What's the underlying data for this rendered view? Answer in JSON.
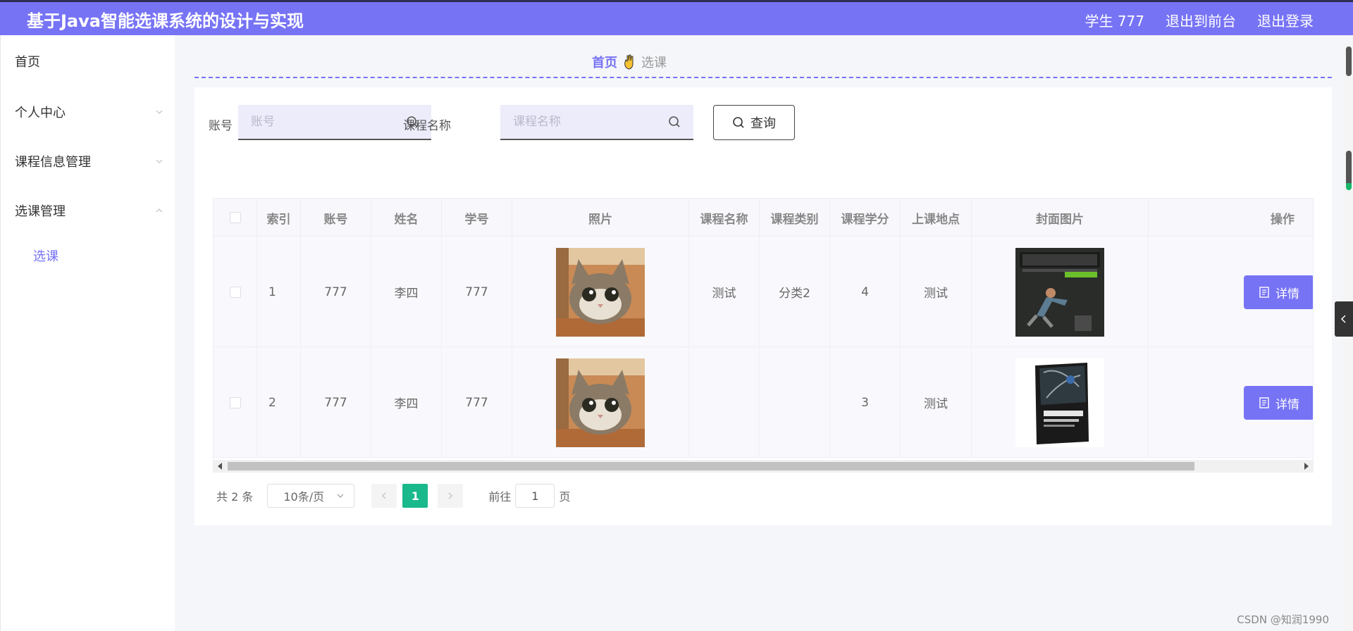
{
  "header": {
    "title": "基于Java智能选课系统的设计与实现",
    "user_label": "学生 777",
    "front_link": "退出到前台",
    "logout_link": "退出登录"
  },
  "sidebar": {
    "items": [
      {
        "label": "首页"
      },
      {
        "label": "个人中心"
      },
      {
        "label": "课程信息管理"
      },
      {
        "label": "选课管理"
      }
    ],
    "subitem": "选课"
  },
  "breadcrumb": {
    "home": "首页",
    "current": "选课"
  },
  "search": {
    "account_label": "账号",
    "account_placeholder": "账号",
    "course_label": "课程名称",
    "course_placeholder": "课程名称",
    "query_button": "查询"
  },
  "table": {
    "columns": [
      "索引",
      "账号",
      "姓名",
      "学号",
      "照片",
      "课程名称",
      "课程类别",
      "课程学分",
      "上课地点",
      "封面图片",
      "操作"
    ],
    "rows": [
      {
        "index": "1",
        "account": "777",
        "name": "李四",
        "student_no": "777",
        "course_name": "测试",
        "course_type": "分类2",
        "credits": "4",
        "location": "测试",
        "action": "详情"
      },
      {
        "index": "2",
        "account": "777",
        "name": "李四",
        "student_no": "777",
        "course_name": "",
        "course_type": "",
        "credits": "3",
        "location": "测试",
        "action": "详情"
      }
    ]
  },
  "pagination": {
    "total": "共 2 条",
    "page_size": "10条/页",
    "current_page": "1",
    "goto_label": "前往",
    "goto_value": "1",
    "page_suffix": "页"
  },
  "watermark": "CSDN @知润1990",
  "colors": {
    "accent": "#7773f5",
    "page_active": "#19b98c"
  }
}
